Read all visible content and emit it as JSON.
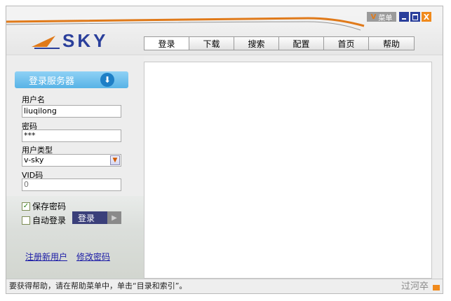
{
  "header": {
    "logo_text": "SKY",
    "menu_label": "菜单",
    "menu_arrow": "V",
    "close_label": "X"
  },
  "tabs": [
    {
      "label": "登录",
      "active": true
    },
    {
      "label": "下载",
      "active": false
    },
    {
      "label": "搜索",
      "active": false
    },
    {
      "label": "配置",
      "active": false
    },
    {
      "label": "首页",
      "active": false
    },
    {
      "label": "帮助",
      "active": false
    }
  ],
  "login": {
    "server_button": "登录服务器",
    "username_label": "用户名",
    "username_value": "liuqilong",
    "password_label": "密码",
    "password_value": "***",
    "user_type_label": "用户类型",
    "user_type_value": "v-sky",
    "vid_label": "VID码",
    "vid_value": "0",
    "save_password": "保存密码",
    "save_password_checked": true,
    "auto_login": "自动登录",
    "auto_login_checked": false,
    "login_button": "登录"
  },
  "links": {
    "register": "注册新用户",
    "change_password": "修改密码"
  },
  "status": {
    "text": "要获得帮助，请在帮助菜单中，单击“目录和索引”。"
  },
  "watermark": "过河卒",
  "colors": {
    "accent_orange": "#f08a1c",
    "brand_blue": "#2a3f9b",
    "server_button": "#57b3e6",
    "login_button": "#3a3f7a"
  }
}
